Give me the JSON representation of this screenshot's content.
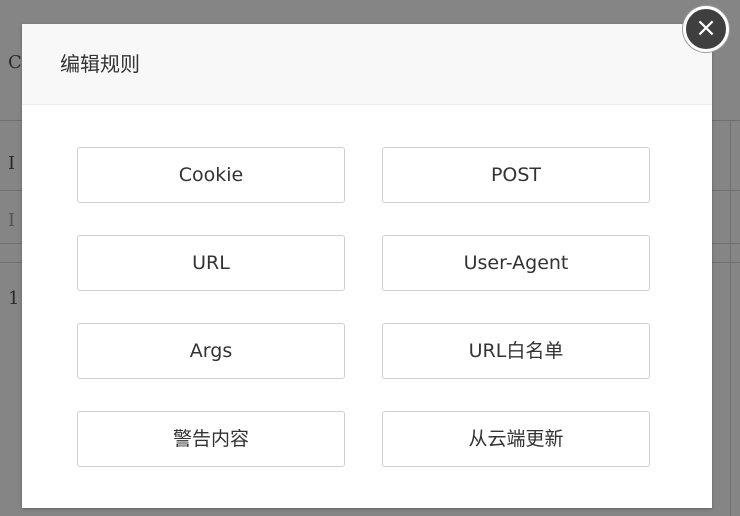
{
  "background_page": {
    "fragments": [
      "C",
      "I",
      "I",
      "1"
    ]
  },
  "modal": {
    "title": "编辑规则",
    "close_symbol": "×",
    "buttons": [
      {
        "label": "Cookie"
      },
      {
        "label": "POST"
      },
      {
        "label": "URL"
      },
      {
        "label": "User-Agent"
      },
      {
        "label": "Args"
      },
      {
        "label": "URL白名单"
      },
      {
        "label": "警告内容"
      },
      {
        "label": "从云端更新"
      }
    ]
  },
  "colors": {
    "backdrop": "#858585",
    "header_bg": "#f8f8f8",
    "close_button_bg": "#3f3f3f",
    "button_border": "#cfcfcf",
    "text": "#333333"
  }
}
